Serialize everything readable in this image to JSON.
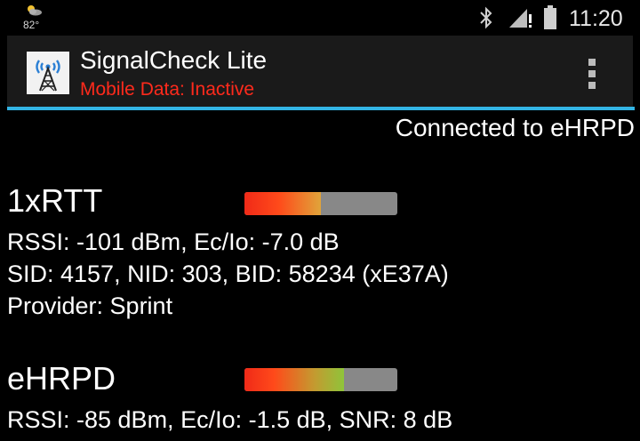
{
  "status_bar": {
    "temperature": "82°",
    "time": "11:20",
    "icons": [
      "weather-icon",
      "bluetooth-icon",
      "signal-icon",
      "battery-icon"
    ]
  },
  "app_bar": {
    "title": "SignalCheck Lite",
    "subtitle": "Mobile Data: Inactive",
    "subtitle_color": "#ff2a1c",
    "accent_color": "#33b5e5",
    "logo_icon": "cell-tower-icon",
    "menu_icon": "overflow-menu-icon"
  },
  "connection_status": "Connected to eHRPD",
  "networks": [
    {
      "name": "1xRTT",
      "signal_level": 0.5,
      "fill_gradient": "linear-gradient(90deg, #f02a18 0%, #ff4a1a 45%, #e0a43a 100%)",
      "lines": [
        "RSSI: -101 dBm, Ec/Io: -7.0 dB",
        "SID: 4157, NID: 303, BID: 58234 (xE37A)",
        "Provider: Sprint"
      ]
    },
    {
      "name": "eHRPD",
      "signal_level": 0.65,
      "fill_gradient": "linear-gradient(90deg, #f02a18 0%, #ff4a1a 30%, #c49a30 70%, #8fc43a 100%)",
      "lines": [
        "RSSI: -85 dBm, Ec/Io: -1.5 dB, SNR: 8 dB"
      ]
    }
  ]
}
